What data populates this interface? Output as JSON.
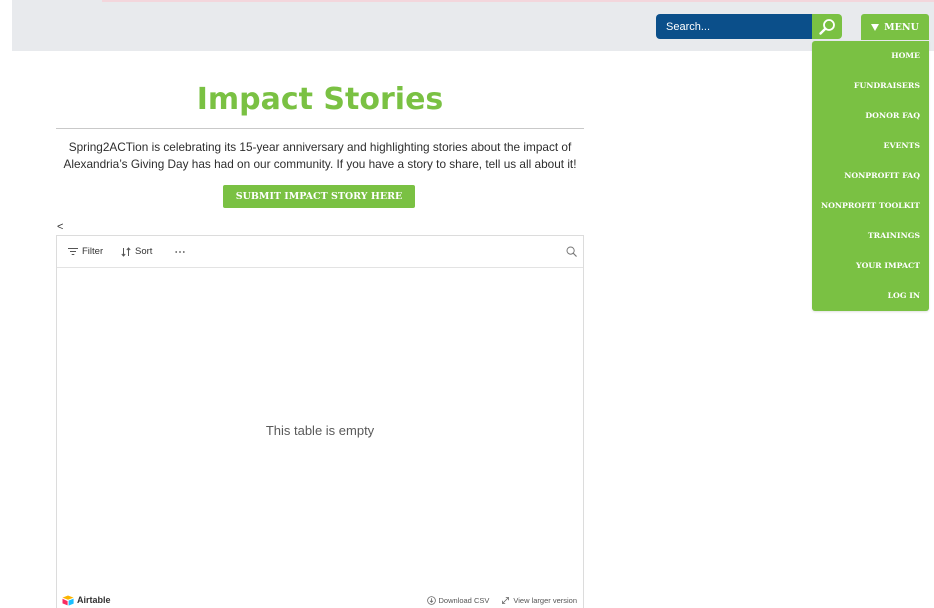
{
  "header": {
    "search": {
      "placeholder": "Search..."
    },
    "menu_label": "MENU"
  },
  "menu": {
    "items": [
      "HOME",
      "FUNDRAISERS",
      "DONOR FAQ",
      "EVENTS",
      "NONPROFIT FAQ",
      "NONPROFIT TOOLKIT",
      "TRAININGS",
      "YOUR IMPACT",
      "LOG IN"
    ]
  },
  "main": {
    "title": "Impact Stories",
    "intro": "Spring2ACTion is celebrating its 15-year anniversary and highlighting stories about the impact of Alexandria’s Giving Day has had on our community. If you have a story to share, tell us all about it!",
    "submit_label": "SUBMIT IMPACT STORY HERE",
    "back_label": "<"
  },
  "airtable": {
    "toolbar": {
      "filter_label": "Filter",
      "sort_label": "Sort"
    },
    "empty_text": "This table is empty",
    "footer": {
      "brand": "Airtable",
      "download_label": "Download CSV",
      "view_larger_label": "View larger version"
    }
  },
  "icons": {
    "search_button": "search-icon",
    "menu_caret": "caret-down-icon",
    "filter": "filter-icon",
    "sort": "sort-icon",
    "more": "more-icon",
    "table_search": "search-icon",
    "brand_logo": "airtable-logo-icon",
    "download": "download-icon",
    "view_larger": "expand-icon"
  },
  "colors": {
    "accent_green": "#7ac143",
    "search_blue": "#0b4f8a",
    "header_gray": "#e8eaed",
    "top_bar_pink": "#f3d6dc"
  }
}
